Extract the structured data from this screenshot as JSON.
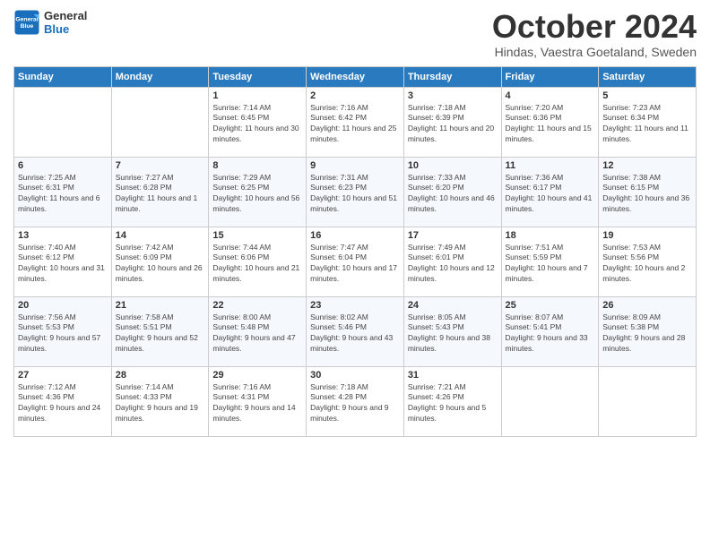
{
  "logo": {
    "line1": "General",
    "line2": "Blue"
  },
  "title": "October 2024",
  "subtitle": "Hindas, Vaestra Goetaland, Sweden",
  "weekdays": [
    "Sunday",
    "Monday",
    "Tuesday",
    "Wednesday",
    "Thursday",
    "Friday",
    "Saturday"
  ],
  "weeks": [
    [
      {
        "day": "",
        "info": ""
      },
      {
        "day": "",
        "info": ""
      },
      {
        "day": "1",
        "info": "Sunrise: 7:14 AM\nSunset: 6:45 PM\nDaylight: 11 hours and 30 minutes."
      },
      {
        "day": "2",
        "info": "Sunrise: 7:16 AM\nSunset: 6:42 PM\nDaylight: 11 hours and 25 minutes."
      },
      {
        "day": "3",
        "info": "Sunrise: 7:18 AM\nSunset: 6:39 PM\nDaylight: 11 hours and 20 minutes."
      },
      {
        "day": "4",
        "info": "Sunrise: 7:20 AM\nSunset: 6:36 PM\nDaylight: 11 hours and 15 minutes."
      },
      {
        "day": "5",
        "info": "Sunrise: 7:23 AM\nSunset: 6:34 PM\nDaylight: 11 hours and 11 minutes."
      }
    ],
    [
      {
        "day": "6",
        "info": "Sunrise: 7:25 AM\nSunset: 6:31 PM\nDaylight: 11 hours and 6 minutes."
      },
      {
        "day": "7",
        "info": "Sunrise: 7:27 AM\nSunset: 6:28 PM\nDaylight: 11 hours and 1 minute."
      },
      {
        "day": "8",
        "info": "Sunrise: 7:29 AM\nSunset: 6:25 PM\nDaylight: 10 hours and 56 minutes."
      },
      {
        "day": "9",
        "info": "Sunrise: 7:31 AM\nSunset: 6:23 PM\nDaylight: 10 hours and 51 minutes."
      },
      {
        "day": "10",
        "info": "Sunrise: 7:33 AM\nSunset: 6:20 PM\nDaylight: 10 hours and 46 minutes."
      },
      {
        "day": "11",
        "info": "Sunrise: 7:36 AM\nSunset: 6:17 PM\nDaylight: 10 hours and 41 minutes."
      },
      {
        "day": "12",
        "info": "Sunrise: 7:38 AM\nSunset: 6:15 PM\nDaylight: 10 hours and 36 minutes."
      }
    ],
    [
      {
        "day": "13",
        "info": "Sunrise: 7:40 AM\nSunset: 6:12 PM\nDaylight: 10 hours and 31 minutes."
      },
      {
        "day": "14",
        "info": "Sunrise: 7:42 AM\nSunset: 6:09 PM\nDaylight: 10 hours and 26 minutes."
      },
      {
        "day": "15",
        "info": "Sunrise: 7:44 AM\nSunset: 6:06 PM\nDaylight: 10 hours and 21 minutes."
      },
      {
        "day": "16",
        "info": "Sunrise: 7:47 AM\nSunset: 6:04 PM\nDaylight: 10 hours and 17 minutes."
      },
      {
        "day": "17",
        "info": "Sunrise: 7:49 AM\nSunset: 6:01 PM\nDaylight: 10 hours and 12 minutes."
      },
      {
        "day": "18",
        "info": "Sunrise: 7:51 AM\nSunset: 5:59 PM\nDaylight: 10 hours and 7 minutes."
      },
      {
        "day": "19",
        "info": "Sunrise: 7:53 AM\nSunset: 5:56 PM\nDaylight: 10 hours and 2 minutes."
      }
    ],
    [
      {
        "day": "20",
        "info": "Sunrise: 7:56 AM\nSunset: 5:53 PM\nDaylight: 9 hours and 57 minutes."
      },
      {
        "day": "21",
        "info": "Sunrise: 7:58 AM\nSunset: 5:51 PM\nDaylight: 9 hours and 52 minutes."
      },
      {
        "day": "22",
        "info": "Sunrise: 8:00 AM\nSunset: 5:48 PM\nDaylight: 9 hours and 47 minutes."
      },
      {
        "day": "23",
        "info": "Sunrise: 8:02 AM\nSunset: 5:46 PM\nDaylight: 9 hours and 43 minutes."
      },
      {
        "day": "24",
        "info": "Sunrise: 8:05 AM\nSunset: 5:43 PM\nDaylight: 9 hours and 38 minutes."
      },
      {
        "day": "25",
        "info": "Sunrise: 8:07 AM\nSunset: 5:41 PM\nDaylight: 9 hours and 33 minutes."
      },
      {
        "day": "26",
        "info": "Sunrise: 8:09 AM\nSunset: 5:38 PM\nDaylight: 9 hours and 28 minutes."
      }
    ],
    [
      {
        "day": "27",
        "info": "Sunrise: 7:12 AM\nSunset: 4:36 PM\nDaylight: 9 hours and 24 minutes."
      },
      {
        "day": "28",
        "info": "Sunrise: 7:14 AM\nSunset: 4:33 PM\nDaylight: 9 hours and 19 minutes."
      },
      {
        "day": "29",
        "info": "Sunrise: 7:16 AM\nSunset: 4:31 PM\nDaylight: 9 hours and 14 minutes."
      },
      {
        "day": "30",
        "info": "Sunrise: 7:18 AM\nSunset: 4:28 PM\nDaylight: 9 hours and 9 minutes."
      },
      {
        "day": "31",
        "info": "Sunrise: 7:21 AM\nSunset: 4:26 PM\nDaylight: 9 hours and 5 minutes."
      },
      {
        "day": "",
        "info": ""
      },
      {
        "day": "",
        "info": ""
      }
    ]
  ]
}
